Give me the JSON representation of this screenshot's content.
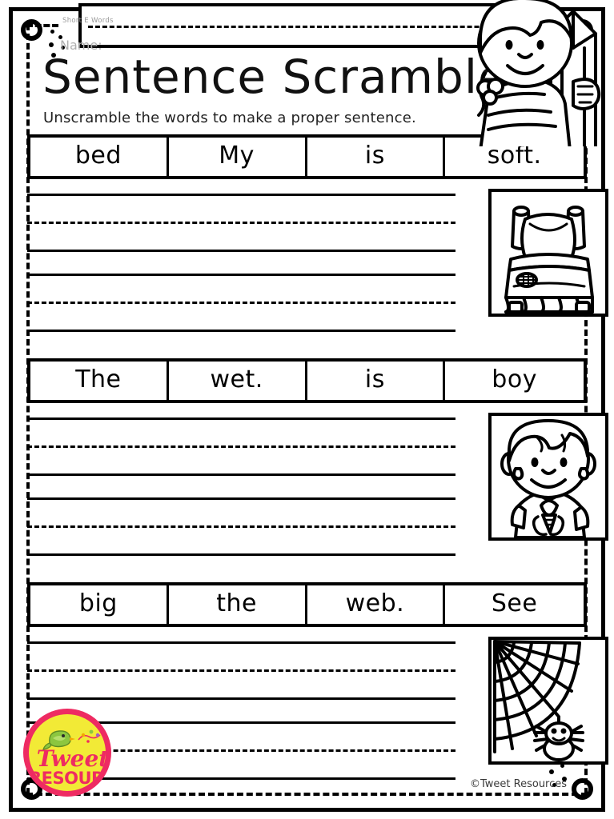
{
  "page": {
    "subject_tag": "Short E Words",
    "name_label": "Name:",
    "title": "Sentence Scramble",
    "subtitle": "Unscramble the words to make a proper sentence.",
    "copyright": "©Tweet Resources"
  },
  "logo": {
    "line1": "Tweet",
    "line2": "RESOURCES",
    "circle_fill": "#f2ea36",
    "ring_color": "#ee2b62",
    "text_color": "#ee2b62",
    "bird_color": "#8cc63f"
  },
  "colors": {
    "ink": "#000000",
    "paper": "#ffffff",
    "muted_text": "#a8a8a8"
  },
  "exercises": [
    {
      "id": "exercise-1",
      "words": [
        "bed",
        "My",
        "is",
        "soft."
      ],
      "picture": "bed-illustration",
      "picture_label": "bed"
    },
    {
      "id": "exercise-2",
      "words": [
        "The",
        "wet.",
        "is",
        "boy"
      ],
      "picture": "wet-boy-illustration",
      "picture_label": "wet boy"
    },
    {
      "id": "exercise-3",
      "words": [
        "big",
        "the",
        "web.",
        "See"
      ],
      "picture": "spider-web-illustration",
      "picture_label": "spider web"
    }
  ]
}
